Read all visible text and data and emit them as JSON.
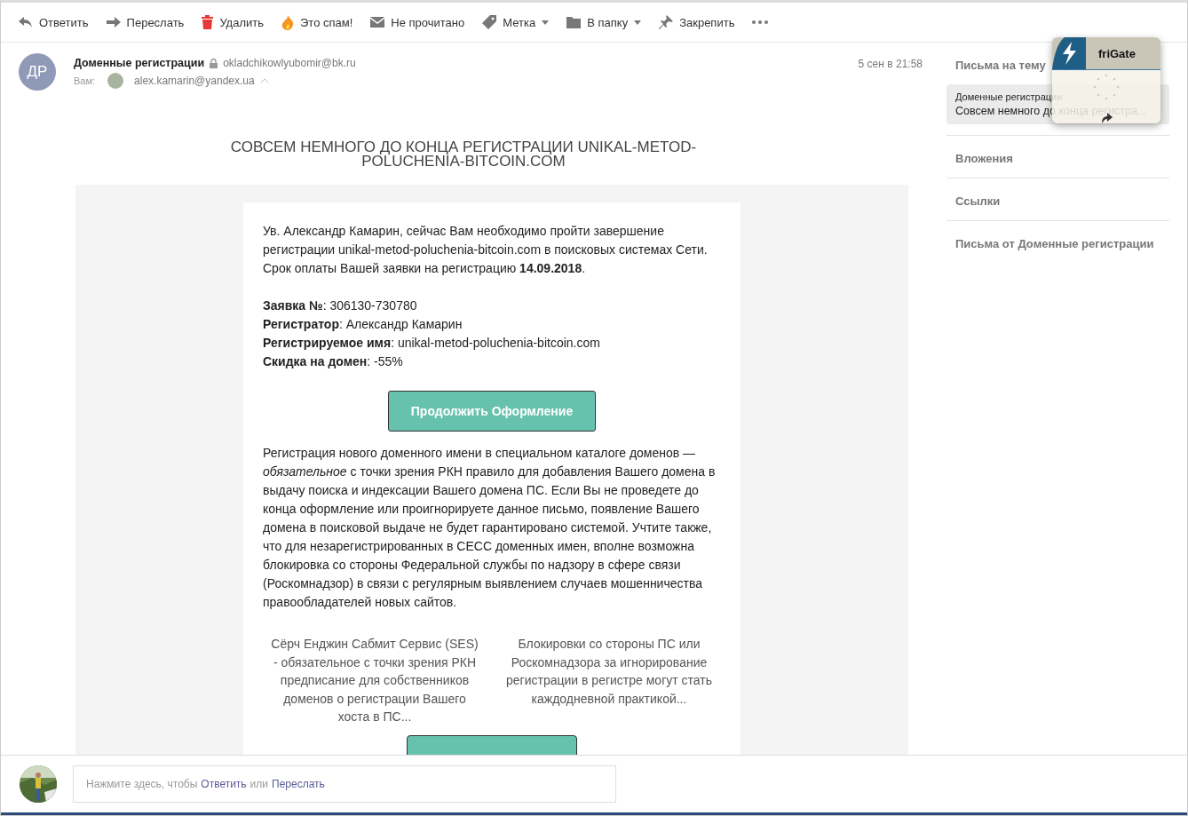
{
  "toolbar": [
    {
      "kind": "reply",
      "label": "Ответить",
      "dropdown": false
    },
    {
      "kind": "forward",
      "label": "Переслать",
      "dropdown": false
    },
    {
      "kind": "delete",
      "label": "Удалить",
      "dropdown": false
    },
    {
      "kind": "spam",
      "label": "Это спам!",
      "dropdown": false
    },
    {
      "kind": "unread",
      "label": "Не прочитано",
      "dropdown": false
    },
    {
      "kind": "tag",
      "label": "Метка",
      "dropdown": true
    },
    {
      "kind": "folder",
      "label": "В папку",
      "dropdown": true
    },
    {
      "kind": "pin",
      "label": "Закрепить",
      "dropdown": false
    },
    {
      "kind": "more",
      "dropdown": false
    }
  ],
  "message": {
    "avatar_initials": "ДР",
    "sender": "Доменные регистрации",
    "sender_email": "okladchikowlyubomir@bk.ru",
    "to_label": "Вам:",
    "to_email": "alex.kamarin@yandex.ua",
    "date": "5 сен в 21:58",
    "title": "СОВСЕМ НЕМНОГО ДО КОНЦА РЕГИСТРАЦИИ UNIKAL-METOD-POLUCHENIA-BITCOIN.COM",
    "intro": "Ув. Александр Камарин, сейчас Вам необходимо пройти завершение регистрации unikal-metod-poluchenia-bitcoin.com в поисковых системах Сети. Срок оплаты Вашей заявки на регистрацию **14.09.2018**.",
    "fields": [
      "**Заявка №**: 306130-730780",
      "**Регистратор**: Александр Камарин",
      "**Регистрируемое имя**: unikal-metod-poluchenia-bitcoin.com",
      "**Скидка на домен**: -55%"
    ],
    "button": "Продолжить Оформление",
    "paragraph": "Регистрация нового доменного имени в специальном каталоге доменов — *обязательное* с точки зрения РКН правило для добавления Вашего домена в выдачу поиска и индексации Вашего домена ПС. Если Вы не проведете до конца оформление или проигнорируете данное письмо, появление Вашего домена в поисковой выдаче не будет гарантировано системой. Учтите также, что для незарегистрированных в СЕСС доменных имен, вполне возможна блокировка со стороны Федеральной службы по надзору в сфере связи (Роскомнадзор) в связи с регулярным выявлением случаев мошенничества правообладателей новых сайтов.",
    "columns": [
      "Сёрч Енджин Сабмит Сервис (SES) - обязательное с точки зрения РКН предписание для собственников доменов о регистрации Вашего хоста в ПС...",
      "Блокировки со стороны ПС или Роскомнадзора за игнорирование регистрации в регистре могут стать каждодневной практикой..."
    ]
  },
  "sidebar": {
    "thread_title": "Письма на тему",
    "thread_item": {
      "sender": "Доменные регистрации",
      "subject": "Совсем немного до конца регистра...",
      "selected": true
    },
    "sections": [
      "Вложения",
      "Ссылки",
      "Письма от Доменные регистрации"
    ]
  },
  "frigate": {
    "title": "friGate"
  },
  "reply_bar": {
    "prefix": "Нажмите здесь, чтобы",
    "reply_link": "Ответить",
    "middle": "или",
    "forward_link": "Переслать"
  }
}
